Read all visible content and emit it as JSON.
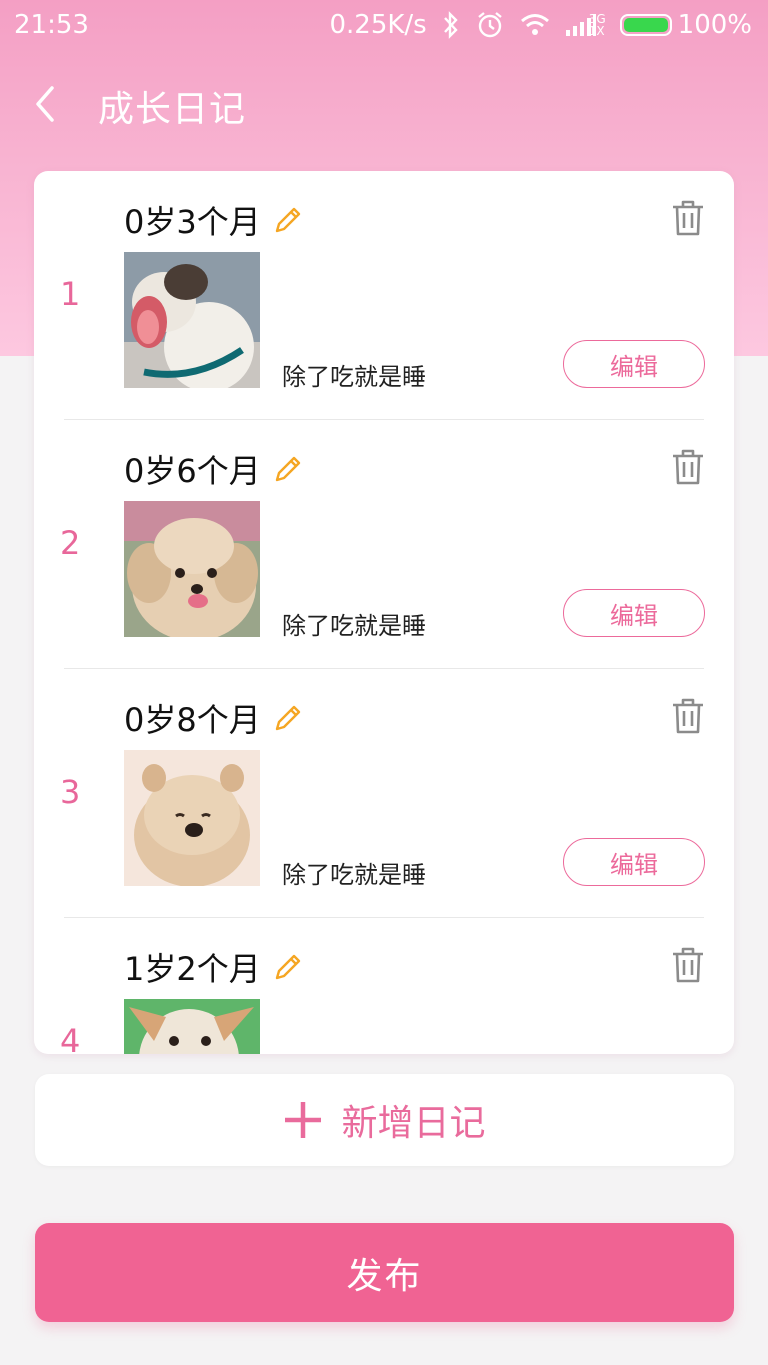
{
  "status_bar": {
    "time": "21:53",
    "speed": "0.25K/s",
    "net_type_top": "3G",
    "net_type_bottom": "1X",
    "battery": "100%",
    "battery_level": 1.0,
    "battery_color": "#39d74d"
  },
  "header": {
    "title": "成长日记"
  },
  "entries": [
    {
      "index": "1",
      "age": "0岁3个月",
      "caption": "除了吃就是睡",
      "edit_label": "编辑",
      "photo": "dog-photo-yawning-puppy"
    },
    {
      "index": "2",
      "age": "0岁6个月",
      "caption": "除了吃就是睡",
      "edit_label": "编辑",
      "photo": "dog-photo-poodle"
    },
    {
      "index": "3",
      "age": "0岁8个月",
      "caption": "除了吃就是睡",
      "edit_label": "编辑",
      "photo": "dog-photo-chow"
    },
    {
      "index": "4",
      "age": "1岁2个月",
      "caption": "",
      "edit_label": "",
      "photo": "dog-photo-shiba"
    }
  ],
  "add_button": {
    "label": "新增日记"
  },
  "publish_button": {
    "label": "发布"
  },
  "colors": {
    "accent": "#f06393",
    "pencil": "#f5a623",
    "index": "#e8679a"
  }
}
